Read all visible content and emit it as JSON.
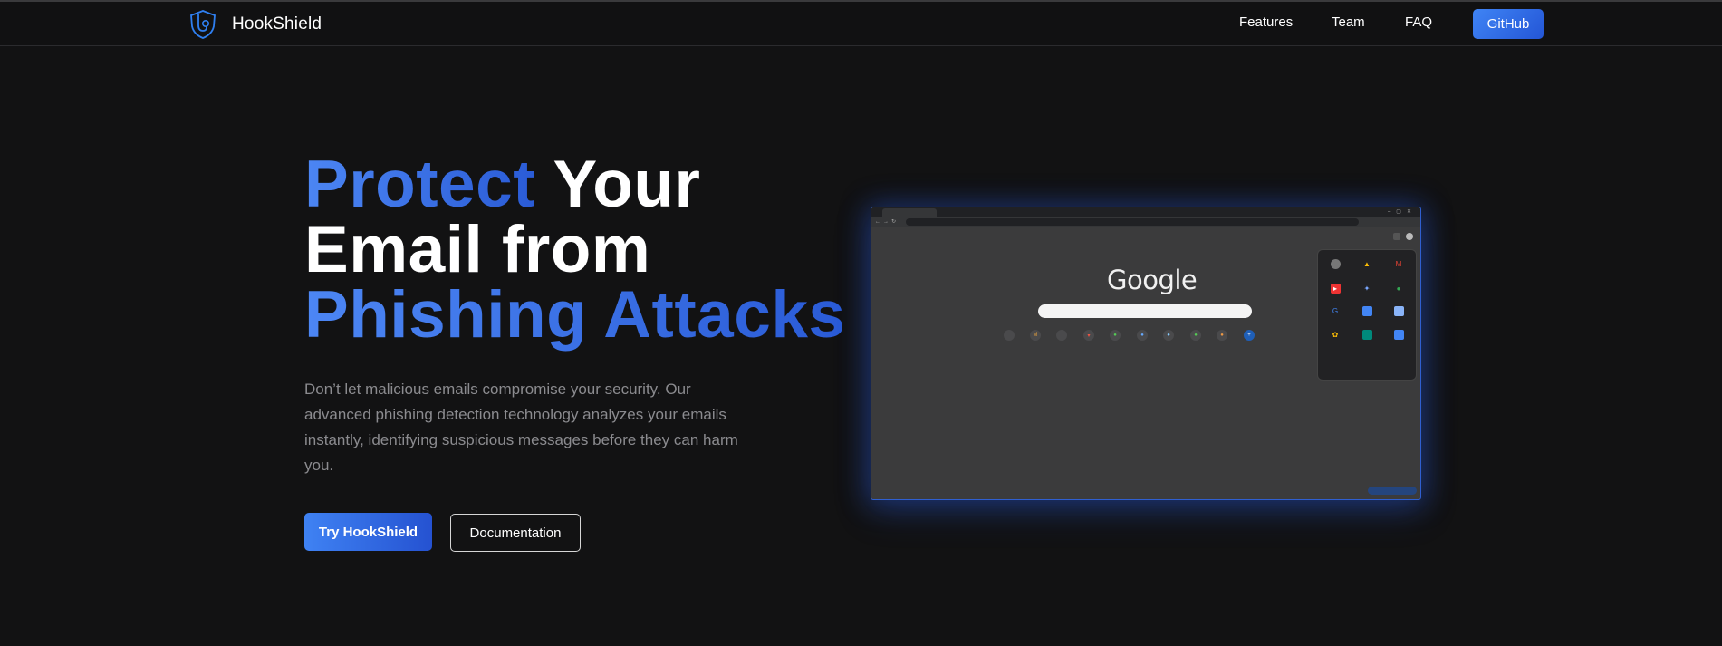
{
  "nav": {
    "brand": "HookShield",
    "links": [
      "Features",
      "Team",
      "FAQ"
    ],
    "github": "GitHub"
  },
  "hero": {
    "title_blue_1": "Protect",
    "title_white_1": "Your",
    "title_white_2": "Email from",
    "title_blue_2": "Phishing Attacks",
    "description": "Don’t let malicious emails compromise your security. Our advanced phishing detection technology analyzes your emails instantly, identifying suspicious messages before they can harm you.",
    "primary_button": "Try HookShield",
    "secondary_button": "Documentation"
  },
  "screenshot": {
    "google_logo": "Google",
    "colors": {
      "accent": "#3a73e8",
      "accent_dark": "#2456d6",
      "background": "#121213"
    }
  }
}
